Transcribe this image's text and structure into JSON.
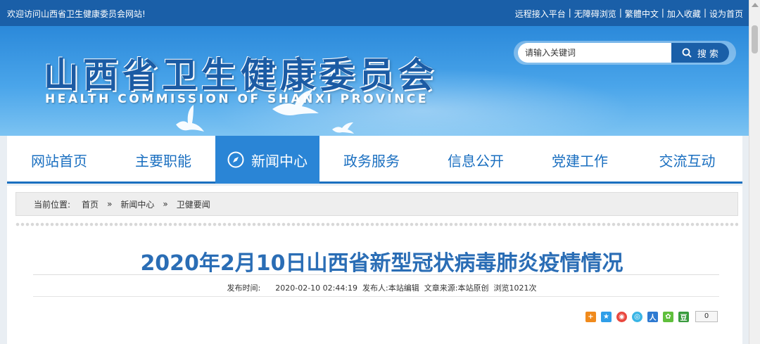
{
  "topbar": {
    "welcome": "欢迎访问山西省卫生健康委员会网站!",
    "links": [
      "远程接入平台",
      "无障碍浏览",
      "繁體中文",
      "加入收藏",
      "设为首页"
    ],
    "separator": "|"
  },
  "banner": {
    "title_cn": "山西省卫生健康委员会",
    "title_en": "HEALTH COMMISSION OF SHANXI PROVINCE"
  },
  "search": {
    "placeholder": "请输入关键词",
    "button_label": "搜 索"
  },
  "nav": {
    "items": [
      {
        "label": "网站首页"
      },
      {
        "label": "主要职能"
      },
      {
        "label": "新闻中心"
      },
      {
        "label": "政务服务"
      },
      {
        "label": "信息公开"
      },
      {
        "label": "党建工作"
      },
      {
        "label": "交流互动"
      }
    ],
    "active_index": 2
  },
  "breadcrumb": {
    "prefix": "当前位置:",
    "items": [
      "首页",
      "新闻中心",
      "卫健要闻"
    ],
    "arrow": "»"
  },
  "article": {
    "title": "2020年2月10日山西省新型冠状病毒肺炎疫情情况",
    "meta": "发布时间:      2020-02-10 02:44:19  发布人:本站编辑  文章来源:本站原创  浏览1021次"
  },
  "share": {
    "count": "0"
  },
  "colors": {
    "brand_blue": "#1a5fa8",
    "nav_active": "#2a85d6",
    "title_blue": "#2a6db5"
  }
}
